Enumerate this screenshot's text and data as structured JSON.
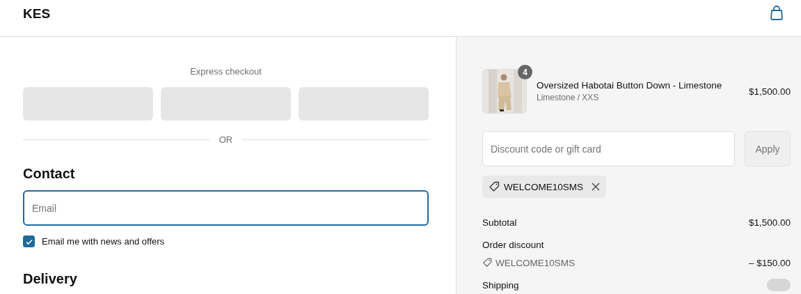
{
  "header": {
    "logo": "KES"
  },
  "express": {
    "label": "Express checkout",
    "buttons": [
      {
        "kind": "placeholder"
      },
      {
        "kind": "placeholder"
      },
      {
        "kind": "placeholder"
      }
    ],
    "divider": "OR"
  },
  "contact": {
    "heading": "Contact",
    "email": {
      "placeholder": "Email",
      "focused": true
    },
    "newsletter": {
      "label": "Email me with news and offers",
      "checked": true
    }
  },
  "delivery": {
    "heading": "Delivery"
  },
  "summary": {
    "item": {
      "kind": "picture",
      "quantity": "4",
      "name": "Oversized Habotai Button Down - Limestone",
      "variant": "Limestone / XXS",
      "price": "$1,500.00"
    },
    "discount": {
      "placeholder": "Discount code or gift card",
      "button": "Apply",
      "disabled": true
    },
    "applied_codes": [
      {
        "code": "WELCOME10SMS"
      }
    ],
    "lines": [
      {
        "kind": "amount",
        "label": "Subtotal",
        "value": "$1,500.00"
      },
      {
        "kind": "heading",
        "label": "Order discount"
      },
      {
        "kind": "code",
        "label": "WELCOME10SMS",
        "value": "– $150.00"
      },
      {
        "kind": "loading",
        "label": "Shipping"
      }
    ]
  }
}
